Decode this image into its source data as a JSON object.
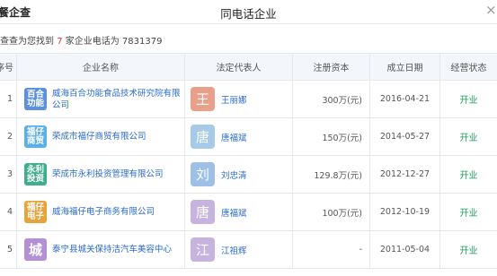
{
  "header": {
    "brand": "餐企查",
    "title": "同电话企业",
    "close": "×"
  },
  "summary": {
    "prefix": "查查为您找到",
    "count": "7",
    "suffix": "家企业电话为 7831379"
  },
  "columns": {
    "index": "序号",
    "company": "企业名称",
    "rep": "法定代表人",
    "capital": "注册资本",
    "date": "成立日期",
    "status": "经营状态"
  },
  "rows": [
    {
      "index": "1",
      "logo": "百合\n功能",
      "logo_color": "#5b8fe0",
      "name": "威海百合功能食品技术研究院有限公司",
      "avatar": "王",
      "avatar_color": "#e8a08a",
      "rep": "王丽娜",
      "capital": "300万(元)",
      "date": "2016-04-21",
      "status": "开业"
    },
    {
      "index": "2",
      "logo": "福仔\n商贸",
      "logo_color": "#5bb0e8",
      "name": "荣成市福仔商贸有限公司",
      "avatar": "唐",
      "avatar_color": "#a6cbe8",
      "rep": "唐福斌",
      "capital": "150万(元)",
      "date": "2014-05-27",
      "status": "开业"
    },
    {
      "index": "3",
      "logo": "永利\n投资",
      "logo_color": "#3fae8a",
      "name": "荣成市永利投资管理有限公司",
      "avatar": "刘",
      "avatar_color": "#9ec0e6",
      "rep": "刘忠清",
      "capital": "129.8万(元)",
      "date": "2012-12-27",
      "status": "开业"
    },
    {
      "index": "4",
      "logo": "福仔\n电子",
      "logo_color": "#e8a33a",
      "name": "威海福仔电子商务有限公司",
      "avatar": "唐",
      "avatar_color": "#c6b4de",
      "rep": "唐福斌",
      "capital": "100万(元)",
      "date": "2012-10-19",
      "status": "开业"
    },
    {
      "index": "5",
      "logo": "城",
      "logo_color": "#b38fd6",
      "name": "泰宁县城关保持洁汽车美容中心",
      "avatar": "江",
      "avatar_color": "#c6b4de",
      "rep": "江祖辉",
      "capital": "-",
      "date": "2011-05-04",
      "status": "开业"
    }
  ]
}
